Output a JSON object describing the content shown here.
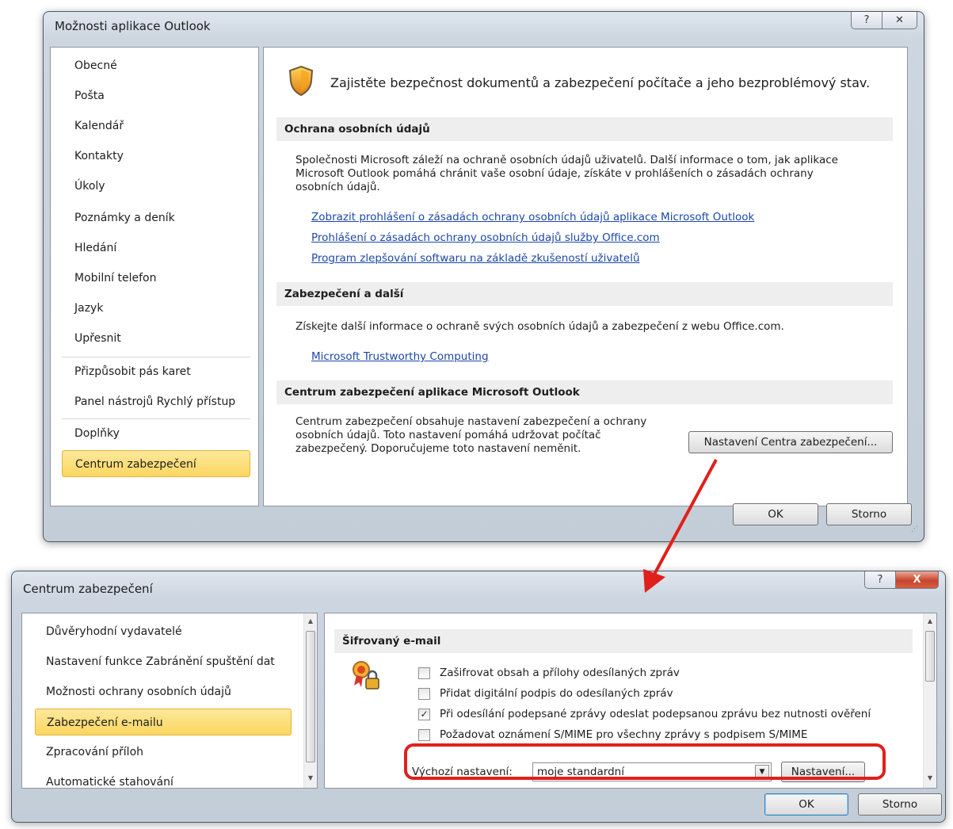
{
  "options_dialog": {
    "title": "Možnosti aplikace Outlook",
    "help_glyph": "?",
    "close_glyph": "✕",
    "nav": [
      {
        "label": "Obecné"
      },
      {
        "label": "Pošta"
      },
      {
        "label": "Kalendář"
      },
      {
        "label": "Kontakty"
      },
      {
        "label": "Úkoly"
      },
      {
        "label": "Poznámky a deník"
      },
      {
        "label": "Hledání"
      },
      {
        "label": "Mobilní telefon"
      },
      {
        "label": "Jazyk"
      },
      {
        "label": "Upřesnit"
      },
      {
        "label": "Přizpůsobit pás karet"
      },
      {
        "label": "Panel nástrojů Rychlý přístup"
      },
      {
        "label": "Doplňky"
      },
      {
        "label": "Centrum zabezpečení",
        "selected": true
      }
    ],
    "header_text": "Zajistěte bezpečnost dokumentů a zabezpečení počítače a jeho bezproblémový stav.",
    "privacy": {
      "heading": "Ochrana osobních údajů",
      "text_lines": [
        "Společnosti Microsoft záleží na ochraně osobních údajů uživatelů. Další informace o tom, jak aplikace",
        "Microsoft Outlook pomáhá chránit vaše osobní údaje, získáte v prohlášeních o zásadách ochrany",
        "osobních údajů."
      ],
      "links": [
        "Zobrazit prohlášení o zásadách ochrany osobních údajů aplikace Microsoft Outlook",
        "Prohlášení o zásadách ochrany osobních údajů služby Office.com",
        "Program zlepšování softwaru na základě zkušeností uživatelů"
      ]
    },
    "security": {
      "heading": "Zabezpečení a další",
      "text": "Získejte další informace o ochraně svých osobních údajů a zabezpečení z webu Office.com.",
      "link": "Microsoft Trustworthy Computing"
    },
    "trust_center": {
      "heading": "Centrum zabezpečení aplikace Microsoft Outlook",
      "text_lines": [
        "Centrum zabezpečení obsahuje nastavení zabezpečení a ochrany",
        "osobních údajů. Toto nastavení pomáhá udržovat počítač",
        "zabezpečený. Doporučujeme toto nastavení neměnit."
      ],
      "button": "Nastavení Centra zabezpečení..."
    },
    "ok": "OK",
    "cancel": "Storno"
  },
  "trust_dialog": {
    "title": "Centrum zabezpečení",
    "help_glyph": "?",
    "close_glyph": "X",
    "nav": [
      {
        "label": "Důvěryhodní vydavatelé"
      },
      {
        "label": "Nastavení funkce Zabránění spuštění dat"
      },
      {
        "label": "Možnosti ochrany osobních údajů"
      },
      {
        "label": "Zabezpečení e-mailu",
        "selected": true
      },
      {
        "label": "Zpracování příloh"
      },
      {
        "label": "Automatické stahování"
      }
    ],
    "encrypted_heading": "Šifrovaný e-mail",
    "checkboxes": [
      {
        "label": "Zašifrovat obsah a přílohy odesílaných zpráv",
        "checked": false
      },
      {
        "label": "Přidat digitální podpis do odesílaných zpráv",
        "checked": false
      },
      {
        "label": "Při odesílání podepsané zprávy odeslat podepsanou zprávu bez nutnosti ověření",
        "checked": true
      },
      {
        "label": "Požadovat oznámení S/MIME pro všechny zprávy s podpisem S/MIME",
        "checked": false
      }
    ],
    "default_setting_label": "Výchozí nastavení:",
    "default_setting_value": "moje standardní",
    "settings_button": "Nastavení...",
    "ok": "OK",
    "cancel": "Storno"
  },
  "annotation_color": "#e0201b"
}
